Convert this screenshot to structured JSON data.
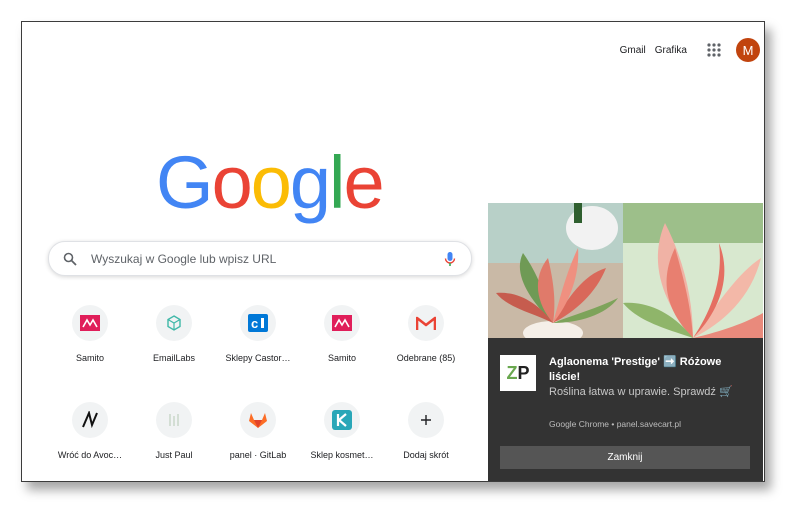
{
  "header": {
    "links": [
      "Gmail",
      "Grafika"
    ],
    "avatar_letter": "M",
    "avatar_color": "#c1440e"
  },
  "logo": {
    "text": "Google",
    "colors": [
      "#4285f4",
      "#ea4335",
      "#fbbc05",
      "#4285f4",
      "#34a853",
      "#ea4335"
    ]
  },
  "search": {
    "placeholder": "Wyszukaj w Google lub wpisz URL"
  },
  "shortcuts": [
    {
      "label": "Samito",
      "icon": "samito-icon"
    },
    {
      "label": "EmailLabs",
      "icon": "emaillabs-icon"
    },
    {
      "label": "Sklepy Castor…",
      "icon": "castorama-icon"
    },
    {
      "label": "Samito",
      "icon": "samito-icon"
    },
    {
      "label": "Odebrane (85)",
      "icon": "gmail-icon"
    },
    {
      "label": "Wróć do Avoc…",
      "icon": "avocado-icon"
    },
    {
      "label": "Just Paul",
      "icon": "justpaul-icon"
    },
    {
      "label": "panel · GitLab",
      "icon": "gitlab-icon"
    },
    {
      "label": "Sklep kosmet…",
      "icon": "shop-k-icon"
    },
    {
      "label": "Dodaj skrót",
      "icon": "plus-icon"
    }
  ],
  "notification": {
    "logo_text": "ZP",
    "title": "Aglaonema 'Prestige' ➡️ Różowe liście!",
    "body": "Roślina łatwa w uprawie. Sprawdź 🛒",
    "source": "Google Chrome • panel.savecart.pl",
    "dismiss_label": "Zamknij"
  }
}
